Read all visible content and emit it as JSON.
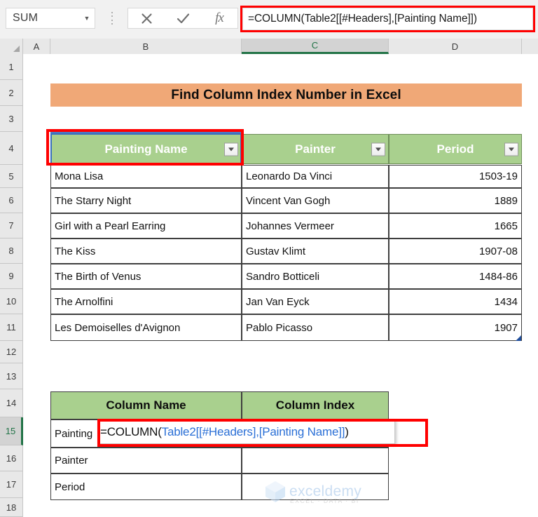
{
  "formula_bar": {
    "name_box_value": "SUM",
    "name_box_caret_icon": "chevron-down-icon",
    "cancel_icon": "cancel-x-icon",
    "confirm_icon": "confirm-check-icon",
    "insert_function_label": "fx",
    "formula_value": "=COLUMN(Table2[[#Headers],[Painting Name]])"
  },
  "grid": {
    "select_all_icon": "select-all-triangle-icon",
    "columns": [
      "A",
      "B",
      "C",
      "D"
    ],
    "active_column": "C",
    "rows": [
      "1",
      "2",
      "3",
      "4",
      "5",
      "6",
      "7",
      "8",
      "9",
      "10",
      "11",
      "12",
      "13",
      "14",
      "15",
      "16",
      "17",
      "18"
    ],
    "active_row": "15"
  },
  "title_banner": {
    "text": "Find Column Index Number in Excel",
    "background": "#F0A877",
    "text_color": "#0D0D0D"
  },
  "table1": {
    "name": "Table2",
    "header_background": "#A9D08E",
    "header_text_color": "#FFFFFF",
    "filter_icon": "filter-dropdown-icon",
    "headers": [
      "Painting Name",
      "Painter",
      "Period"
    ],
    "rows": [
      {
        "painting": "Mona Lisa",
        "painter": "Leonardo Da Vinci",
        "period": "1503-19"
      },
      {
        "painting": "The Starry Night",
        "painter": "Vincent Van Gogh",
        "period": "1889"
      },
      {
        "painting": "Girl with a Pearl Earring",
        "painter": "Johannes Vermeer",
        "period": "1665"
      },
      {
        "painting": "The Kiss",
        "painter": "Gustav Klimt",
        "period": "1907-08"
      },
      {
        "painting": "The Birth of Venus",
        "painter": "Sandro Botticeli",
        "period": "1484-86"
      },
      {
        "painting": "The Arnolfini",
        "painter": "Jan Van Eyck",
        "period": "1434"
      },
      {
        "painting": "Les Demoiselles d'Avignon",
        "painter": "Pablo Picasso",
        "period": "1907"
      }
    ]
  },
  "table2": {
    "header_background": "#A9D08E",
    "header_text_color": "#0D0D0D",
    "headers": [
      "Column Name",
      "Column Index"
    ],
    "rows": [
      {
        "name": "Painting",
        "index": ""
      },
      {
        "name": "Painter",
        "index": ""
      },
      {
        "name": "Period",
        "index": ""
      }
    ]
  },
  "cell_editor": {
    "prefix": "=COLUMN(",
    "reference": "Table2[[#Headers],[Painting Name]]",
    "suffix": ")",
    "reference_color": "#2A6FD6"
  },
  "annotations": {
    "color": "#FF0000",
    "boxes": [
      "formula-bar-highlight",
      "painting-name-header-highlight",
      "cell-formula-highlight"
    ]
  },
  "watermark": {
    "brand": "exceldemy",
    "tagline": "EXCEL · DATA · BI",
    "logo_icon": "exceldemy-logo-icon"
  }
}
